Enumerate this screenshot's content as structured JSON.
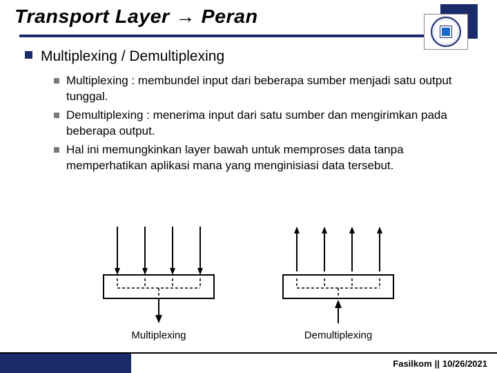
{
  "title": "Transport Layer → Peran",
  "heading": "Multiplexing / Demultiplexing",
  "items": [
    "Multiplexing : membundel input dari beberapa sumber menjadi satu output tunggal.",
    "Demultiplexing : menerima input dari satu sumber dan mengirimkan pada beberapa output.",
    "Hal ini memungkinkan layer bawah untuk memproses data tanpa memperhatikan aplikasi mana yang menginisiasi data tersebut."
  ],
  "diagram": {
    "left_label": "Multiplexing",
    "right_label": "Demultiplexing"
  },
  "footer": {
    "org": "Fasilkom",
    "sep": "||",
    "date": "10/26/2021"
  }
}
